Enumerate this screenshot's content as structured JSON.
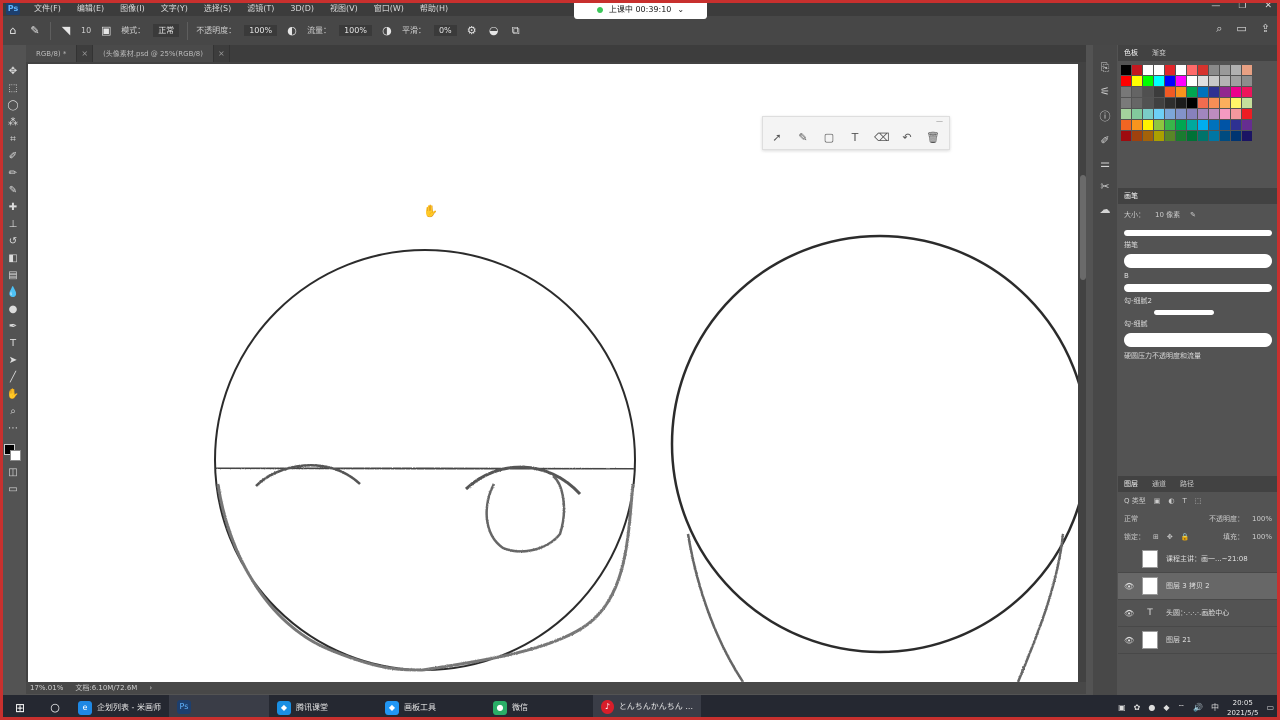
{
  "app": {
    "logo": "Ps",
    "menu": [
      "文件(F)",
      "编辑(E)",
      "图像(I)",
      "文字(Y)",
      "选择(S)",
      "滤镜(T)",
      "3D(D)",
      "视图(V)",
      "窗口(W)",
      "帮助(H)"
    ]
  },
  "live": {
    "text": "上课中 00:39:10",
    "status_color": "#3cc75a"
  },
  "options": {
    "brush_size": "10",
    "mode_label": "模式：",
    "mode_value": "正常",
    "opacity_label": "不透明度：",
    "opacity_value": "100%",
    "flow_label": "流量：",
    "flow_value": "100%",
    "smooth_label": "平滑：",
    "smooth_value": "0%"
  },
  "tabs": [
    {
      "label": "RGB/8) *"
    },
    {
      "label": "(头像素材.psd @ 25%(RGB/8)"
    }
  ],
  "annotation_tools": [
    "select-icon",
    "pen-icon",
    "rect-icon",
    "text-icon",
    "eraser-icon",
    "undo-icon",
    "trash-icon"
  ],
  "status": {
    "zoom": "17%.01%",
    "doc": "文档:6.10M/72.6M"
  },
  "swatches": {
    "tabs": [
      "色板",
      "渐变"
    ],
    "colors": [
      "#000000",
      "#c4181f",
      "#ffffff",
      "#ffffff",
      "#e3262b",
      "#ffffff",
      "#ff6a6a",
      "#d6332d",
      "#8a8a8a",
      "#9a9a9a",
      "#b0b0b0",
      "#e8a083",
      "#ff0000",
      "#ffff00",
      "#00ff00",
      "#00ffff",
      "#0000ff",
      "#ff00ff",
      "#ffffff",
      "#e0e0e0",
      "#c8c8c8",
      "#b4b4b4",
      "#a0a0a0",
      "#8c8c8c",
      "#787878",
      "#646464",
      "#505050",
      "#3c3c3c",
      "#f15a24",
      "#f7941d",
      "#00a651",
      "#0072bc",
      "#2e3192",
      "#92278f",
      "#ec008c",
      "#ed145b",
      "#7a7a7a",
      "#666666",
      "#525252",
      "#404040",
      "#2e2e2e",
      "#1c1c1c",
      "#000000",
      "#f26c4f",
      "#f68e56",
      "#fbaf5d",
      "#fff568",
      "#c4df9b",
      "#a3d39c",
      "#82ca9c",
      "#7accc8",
      "#6dcff6",
      "#7da7d9",
      "#8393ca",
      "#8781bd",
      "#a186be",
      "#bd8cbf",
      "#f49ac1",
      "#f5989d",
      "#ee1d23",
      "#f26522",
      "#f7941d",
      "#fff200",
      "#8dc63f",
      "#39b54a",
      "#00a651",
      "#00a99d",
      "#00aeef",
      "#0072bc",
      "#0054a6",
      "#2e3192",
      "#662d91",
      "#9e0b0f",
      "#a0410d",
      "#a36209",
      "#aba000",
      "#598527",
      "#1a7b30",
      "#007236",
      "#00746b",
      "#0076a3",
      "#004b80",
      "#003471",
      "#1b1464"
    ]
  },
  "brushes": {
    "tabs": [
      "画笔"
    ],
    "size_label": "大小：",
    "size_value": "10 像素",
    "items": [
      "描笔",
      "B",
      "勾-细腻2",
      "勾-细腻",
      "硬圆压力不透明度和流量"
    ]
  },
  "layers": {
    "tabs": [
      "图层",
      "通道",
      "路径"
    ],
    "kind_label": "Q 类型",
    "blend_mode": "正常",
    "opacity_label": "不透明度：",
    "opacity_value": "100%",
    "lock_label": "锁定：",
    "fill_label": "填充：",
    "fill_value": "100%",
    "items": [
      {
        "name": "课程主讲：画一...~21:08",
        "type": "thumb",
        "visible": false
      },
      {
        "name": "图层 3 拷贝 2",
        "type": "thumb",
        "visible": true,
        "selected": true
      },
      {
        "name": "头圆：·.·.·.·.画脸中心",
        "type": "text",
        "visible": true
      },
      {
        "name": "图层 21",
        "type": "thumb",
        "visible": true
      }
    ]
  },
  "taskbar": {
    "items": [
      {
        "label": "企划列表 - 米画师",
        "icon": "browser-icon",
        "color": "#1e88e5"
      },
      {
        "label": "",
        "icon": "ps-icon",
        "color": "#1d3f6e",
        "text": "Ps"
      },
      {
        "label": "腾讯课堂",
        "icon": "tencent-class-icon",
        "color": "#1a8fe3"
      },
      {
        "label": "画板工具",
        "icon": "board-tool-icon",
        "color": "#2196f3"
      },
      {
        "label": "微信",
        "icon": "wechat-icon",
        "color": "#2aae67"
      },
      {
        "label": "とんちんかんちん ...",
        "icon": "music-icon",
        "color": "#d81e2a"
      }
    ],
    "ime": "中",
    "time": "20:05",
    "date": "2021/5/5"
  }
}
